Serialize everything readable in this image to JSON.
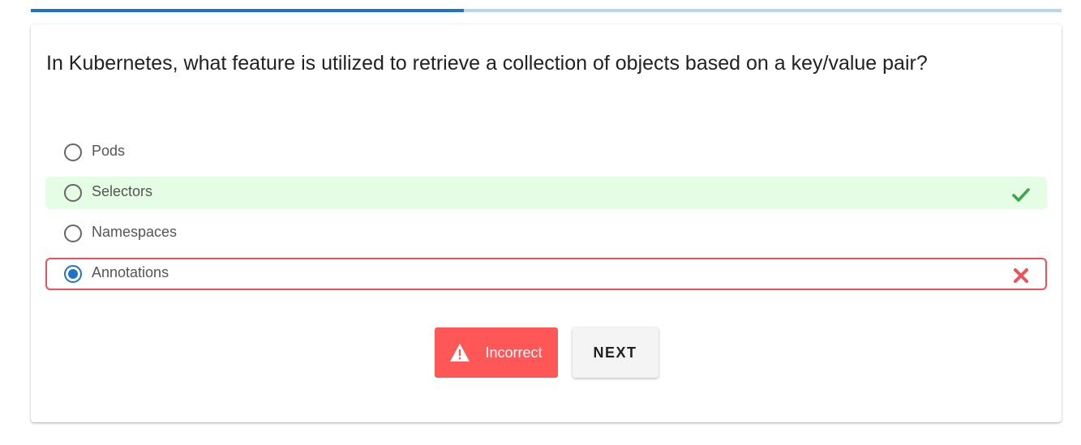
{
  "progress": {
    "fraction": 0.42
  },
  "question": {
    "text": "In Kubernetes, what feature is utilized to retrieve a collection of objects based on a key/value pair?"
  },
  "options": [
    {
      "label": "Pods",
      "state": "none",
      "selected": false
    },
    {
      "label": "Selectors",
      "state": "correct",
      "selected": false,
      "icon": "check-icon"
    },
    {
      "label": "Namespaces",
      "state": "none",
      "selected": false
    },
    {
      "label": "Annotations",
      "state": "wrong",
      "selected": true,
      "icon": "x-icon"
    }
  ],
  "feedback": {
    "label": "Incorrect",
    "icon": "warning-icon"
  },
  "next_button": {
    "label": "NEXT"
  },
  "colors": {
    "accent": "#1e73c8",
    "correct_bg": "#e4fde4",
    "correct_icon": "#3aa84b",
    "wrong": "#f0505a",
    "incorrect_button": "#ff5657"
  }
}
